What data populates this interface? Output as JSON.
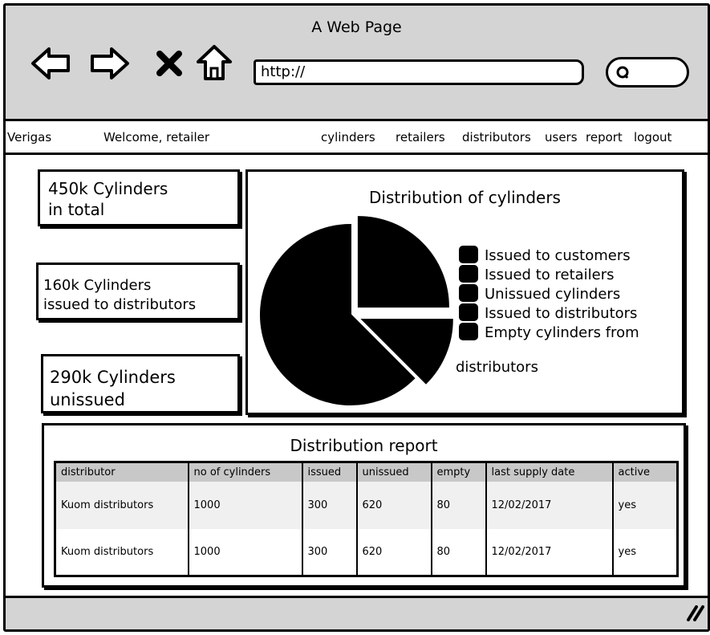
{
  "window": {
    "title": "A Web Page"
  },
  "toolbar": {
    "url": "http://"
  },
  "icons": [
    "back-arrow-icon",
    "forward-arrow-icon",
    "close-x-icon",
    "home-icon",
    "search-icon",
    "resize-grip-icon"
  ],
  "menubar": {
    "brand": "Verigas",
    "welcome": "Welcome, retailer",
    "links": [
      "cylinders",
      "retailers",
      "distributors",
      "users",
      "report",
      "logout"
    ]
  },
  "stats": [
    {
      "line1": "450k Cylinders",
      "line2": "in total"
    },
    {
      "line1": "160k Cylinders",
      "line2": "issued to distributors"
    },
    {
      "line1": "290k Cylinders",
      "line2": "unissued"
    }
  ],
  "chart_data": {
    "type": "pie",
    "title": "Distribution of cylinders",
    "labels": [
      "Issued to customers",
      "Issued to retailers",
      "Unissued cylinders",
      "Issued to distributors",
      "Empty cylinders from distributors"
    ],
    "legend_wrapped_tail": "distributors",
    "slices": [
      {
        "label": "slice-a",
        "value": 0.25,
        "exploded": true
      },
      {
        "label": "slice-b",
        "value": 0.125,
        "exploded": true
      },
      {
        "label": "slice-c",
        "value": 0.625,
        "exploded": false
      }
    ],
    "colors": {
      "fill": "#000000"
    },
    "legend_position": "right"
  },
  "report": {
    "title": "Distribution report",
    "columns": [
      "distributor",
      "no of cylinders",
      "issued",
      "unissued",
      "empty",
      "last supply date",
      "active"
    ],
    "rows": [
      [
        "Kuom distributors",
        "1000",
        "300",
        "620",
        "80",
        "12/02/2017",
        "yes"
      ],
      [
        "Kuom distributors",
        "1000",
        "300",
        "620",
        "80",
        "12/02/2017",
        "yes"
      ]
    ]
  },
  "colors": {
    "chrome": "#d4d4d4",
    "header_row": "#c8c8c8",
    "stripe_row": "#f0f0f0",
    "ink": "#000000"
  }
}
